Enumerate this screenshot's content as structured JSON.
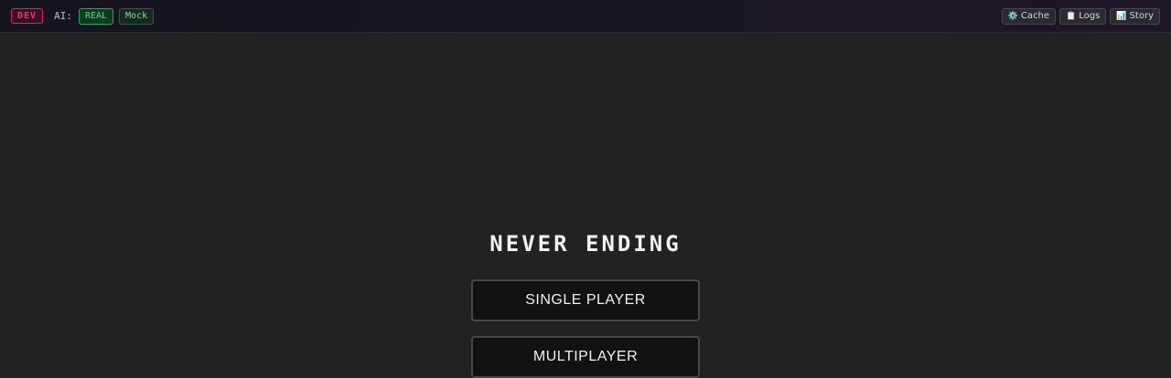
{
  "topbar": {
    "dev_badge": "DEV",
    "ai_label": "AI:",
    "ai_modes": [
      {
        "label": "REAL",
        "active": true
      },
      {
        "label": "Mock",
        "active": false
      }
    ],
    "tools": [
      {
        "icon": "⚙️",
        "icon_name": "gear-icon",
        "label": "Cache"
      },
      {
        "icon": "📋",
        "icon_name": "clipboard-icon",
        "label": "Logs"
      },
      {
        "icon": "📊",
        "icon_name": "chart-icon",
        "label": "Story"
      }
    ]
  },
  "main": {
    "title": "NEVER ENDING",
    "buttons": {
      "single_player": "SINGLE PLAYER",
      "multiplayer": "MULTIPLAYER"
    }
  },
  "colors": {
    "background": "#222222",
    "dev_accent": "#ff2e7a",
    "ai_real_accent": "#38e07a"
  }
}
